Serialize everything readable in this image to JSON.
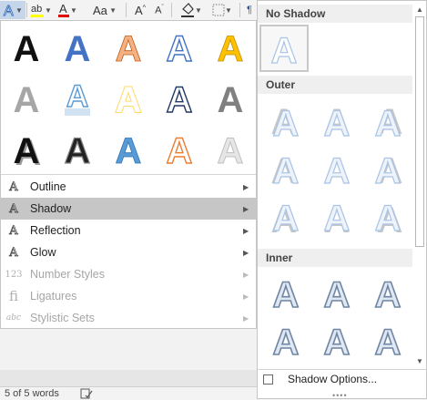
{
  "toolbar": {
    "items": [
      {
        "name": "text-effects-button",
        "glyph": "A"
      },
      {
        "name": "highlight-button",
        "glyph": "ab"
      },
      {
        "name": "font-color-button",
        "glyph": "A"
      },
      {
        "name": "change-case-button",
        "glyph": "Aa"
      },
      {
        "name": "grow-font-button",
        "glyph": "A^"
      },
      {
        "name": "shrink-font-button",
        "glyph": "A"
      },
      {
        "name": "shading-button",
        "glyph": "◊"
      },
      {
        "name": "borders-button",
        "glyph": "▦"
      }
    ],
    "colors": {
      "highlight": "#ffff00",
      "font_color": "#e00000"
    }
  },
  "statusbar": {
    "words": "5 of 5 words"
  },
  "effects_menu": {
    "items": [
      {
        "label": "Outline",
        "underline": "O",
        "icon": "A",
        "enabled": true,
        "selected": false
      },
      {
        "label": "Shadow",
        "underline": "S",
        "icon": "A",
        "enabled": true,
        "selected": true
      },
      {
        "label": "Reflection",
        "underline": "R",
        "icon": "A",
        "enabled": true,
        "selected": false
      },
      {
        "label": "Glow",
        "underline": "G",
        "icon": "A",
        "enabled": true,
        "selected": false
      },
      {
        "label": "Number Styles",
        "underline": "N",
        "icon": "123",
        "enabled": false,
        "selected": false
      },
      {
        "label": "Ligatures",
        "underline": "L",
        "icon": "fi",
        "enabled": false,
        "selected": false
      },
      {
        "label": "Stylistic Sets",
        "underline": "y",
        "icon": "abc",
        "enabled": false,
        "selected": false
      }
    ]
  },
  "shadow_submenu": {
    "sections": [
      {
        "title": "No Shadow"
      },
      {
        "title": "Outer"
      },
      {
        "title": "Inner"
      }
    ],
    "options_label": "Shadow Options..."
  }
}
